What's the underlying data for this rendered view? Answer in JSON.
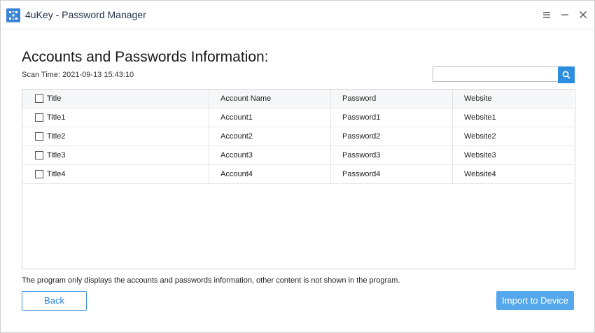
{
  "window": {
    "title": "4uKey - Password Manager",
    "controls": [
      "menu-icon",
      "minimize-icon",
      "close-icon"
    ]
  },
  "main": {
    "title": "Accounts and Passwords Information:",
    "scan_time_label": "Scan Time:",
    "scan_time_value": "2021-09-13 15:43:10"
  },
  "search": {
    "placeholder": "",
    "value": "",
    "icon": "search-icon",
    "accent": "#2d8ee0"
  },
  "table": {
    "headers": [
      "Title",
      "Account Name",
      "Password",
      "Website"
    ],
    "rows": [
      {
        "title": "Title1",
        "account": "Account1",
        "password": "Password1",
        "website": "Website1"
      },
      {
        "title": "Title2",
        "account": "Account2",
        "password": "Password2",
        "website": "Website2"
      },
      {
        "title": "Title3",
        "account": "Account3",
        "password": "Password3",
        "website": "Website3"
      },
      {
        "title": "Title4",
        "account": "Account4",
        "password": "Password4",
        "website": "Website4"
      }
    ]
  },
  "footer": {
    "notice": "The program only displays the accounts and passwords information, other content is not shown in the program.",
    "back_label": "Back",
    "import_label": "Import to Device"
  },
  "colors": {
    "brand": "#3b83d6",
    "primary_button": "#56a8ec",
    "outline_button": "#3a8ee0"
  }
}
